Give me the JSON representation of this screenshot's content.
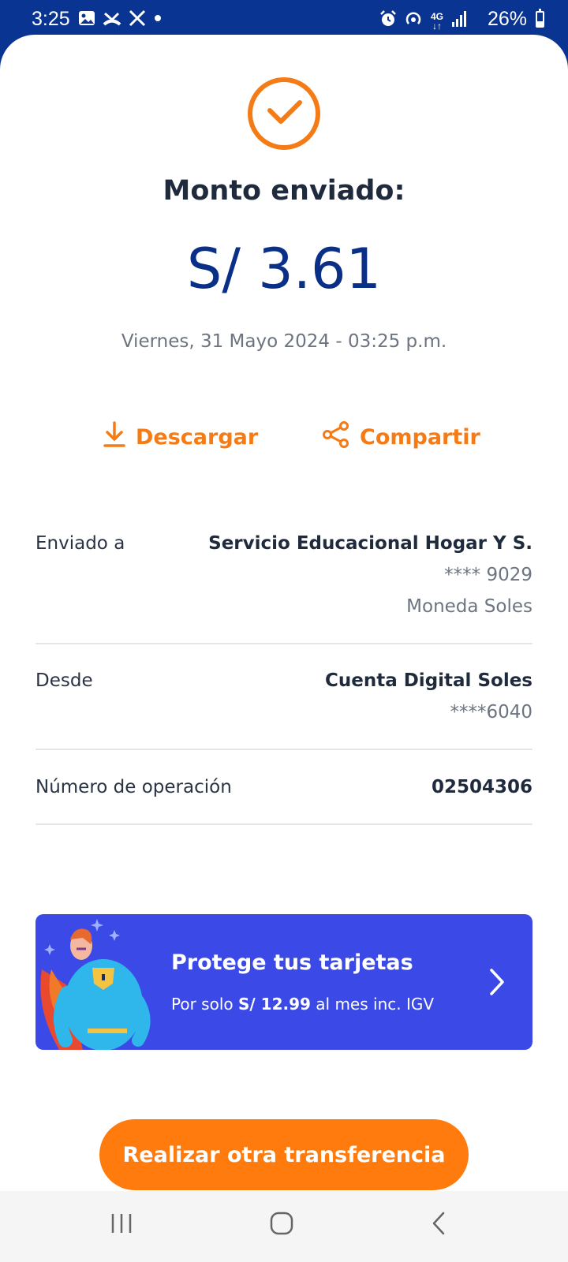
{
  "status_bar": {
    "time": "3:25",
    "battery": "26%",
    "network": "4G",
    "left_icons": [
      "gallery-icon",
      "missed-call-icon",
      "x-icon",
      "dot-icon"
    ],
    "right_icons": [
      "alarm-icon",
      "hotspot-icon",
      "4g-icon",
      "signal-icon",
      "battery-icon"
    ]
  },
  "receipt": {
    "status_icon": "check-circle-icon",
    "title": "Monto enviado:",
    "amount": "S/ 3.61",
    "datetime": "Viernes, 31 Mayo 2024 - 03:25 p.m.",
    "actions": {
      "download_label": "Descargar",
      "share_label": "Compartir"
    },
    "sent_to": {
      "label": "Enviado a",
      "name": "Servicio Educacional Hogar Y S.",
      "account": "**** 9029",
      "currency": "Moneda Soles"
    },
    "from": {
      "label": "Desde",
      "account_name": "Cuenta Digital Soles",
      "account_number": "****6040"
    },
    "operation": {
      "label": "Número de operación",
      "number": "02504306"
    }
  },
  "promo": {
    "title": "Protege tus tarjetas",
    "sub_prefix": "Por solo ",
    "price": "S/ 12.99",
    "sub_suffix": " al mes inc. IGV",
    "color": "#3b4ae6"
  },
  "cta_label": "Realizar otra transferencia",
  "colors": {
    "brand_blue": "#0a3491",
    "accent_orange": "#f47b16",
    "cta_orange": "#ff7b0d"
  }
}
